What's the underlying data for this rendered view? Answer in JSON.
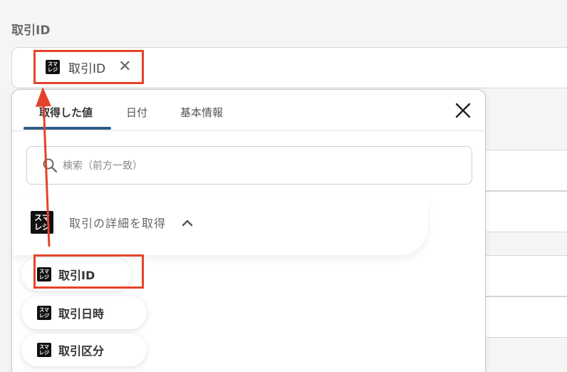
{
  "field": {
    "label": "取引ID"
  },
  "chip": {
    "icon_text_top": "スマ",
    "icon_text_bottom": "レジ",
    "label": "取引ID",
    "close": "✕"
  },
  "popup": {
    "tabs": [
      "取得した値",
      "日付",
      "基本情報"
    ],
    "active_tab": 0,
    "search_placeholder": "検索（前方一致）",
    "section": {
      "title": "取引の詳細を取得",
      "chevron": "⌃"
    },
    "items": [
      "取引ID",
      "取引日時",
      "取引区分"
    ]
  },
  "colors": {
    "highlight": "#e4432a",
    "tab_underline": "#2c5a86",
    "icon_bg": "#111111"
  }
}
